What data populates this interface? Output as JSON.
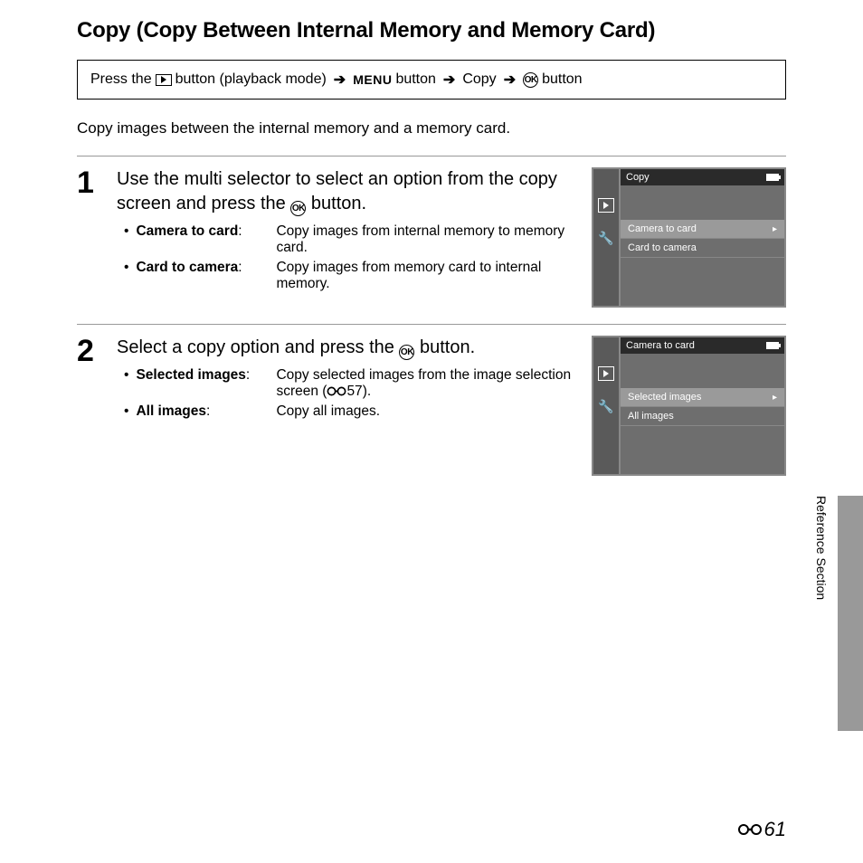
{
  "title": "Copy (Copy Between Internal Memory and Memory Card)",
  "nav": {
    "press_the": "Press the",
    "button_playback": " button (playback mode) ",
    "menu": "MENU",
    "button": " button ",
    "copy": " Copy ",
    "ok_button": " button"
  },
  "intro": "Copy images between the internal memory and a memory card.",
  "steps": [
    {
      "num": "1",
      "title_pre": "Use the multi selector to select an option from the copy screen and press the ",
      "title_post": " button.",
      "options": [
        {
          "label": "Camera to card",
          "desc": "Copy images from internal memory to memory card."
        },
        {
          "label": "Card to camera",
          "desc": "Copy images from memory card to internal memory."
        }
      ],
      "screen": {
        "header": "Copy",
        "items": [
          {
            "label": "Camera to card",
            "selected": true
          },
          {
            "label": "Card to camera",
            "selected": false
          }
        ]
      }
    },
    {
      "num": "2",
      "title_pre": "Select a copy option and press the ",
      "title_post": " button.",
      "options": [
        {
          "label": "Selected images",
          "desc_pre": "Copy selected images from the image selection screen (",
          "desc_ref": "57",
          "desc_post": ")."
        },
        {
          "label": "All images",
          "desc": "Copy all images."
        }
      ],
      "screen": {
        "header": "Camera to card",
        "items": [
          {
            "label": "Selected images",
            "selected": true
          },
          {
            "label": "All images",
            "selected": false
          }
        ]
      }
    }
  ],
  "side_label": "Reference Section",
  "page_number": "61"
}
